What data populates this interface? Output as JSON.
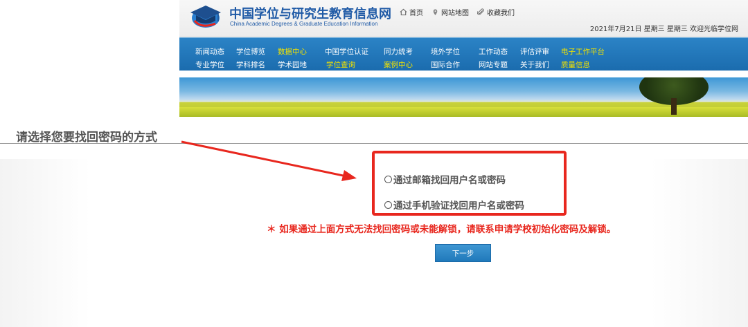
{
  "header": {
    "site_title": "中国学位与研究生教育信息网",
    "site_subtitle": "China Academic Degrees & Graduate Education Information",
    "top_links": [
      {
        "label": "首页",
        "icon": "home-icon"
      },
      {
        "label": "网站地图",
        "icon": "location-pin-icon"
      },
      {
        "label": "收藏我们",
        "icon": "paperclip-icon"
      }
    ],
    "dateline": "2021年7月21日  星期三  星期三  欢迎光临学位网"
  },
  "nav": {
    "row1": [
      {
        "label": "新闻动态",
        "highlight": false
      },
      {
        "label": "学位博览",
        "highlight": false
      },
      {
        "label": "数据中心",
        "highlight": true
      },
      {
        "label": "中国学位认证",
        "highlight": false
      },
      {
        "label": "同力统考",
        "highlight": false
      },
      {
        "label": "境外学位",
        "highlight": false
      },
      {
        "label": "工作动态",
        "highlight": false
      },
      {
        "label": "评估评审",
        "highlight": false
      },
      {
        "label": "电子工作平台",
        "highlight": true
      }
    ],
    "row2": [
      {
        "label": "专业学位",
        "highlight": false
      },
      {
        "label": "学科排名",
        "highlight": false
      },
      {
        "label": "学术园地",
        "highlight": false
      },
      {
        "label": "学位查询",
        "highlight": true
      },
      {
        "label": "案例中心",
        "highlight": true
      },
      {
        "label": "国际合作",
        "highlight": false
      },
      {
        "label": "网站专题",
        "highlight": false
      },
      {
        "label": "关于我们",
        "highlight": false
      },
      {
        "label": "质量信息",
        "highlight": true
      }
    ],
    "highlight_color": "#f2e200"
  },
  "main": {
    "heading": "请选择您要找回密码的方式",
    "options": [
      {
        "label": "通过邮箱找回用户名或密码",
        "selected": false
      },
      {
        "label": "通过手机验证找回用户名或密码",
        "selected": false
      }
    ],
    "notice": "＊ 如果通过上面方式无法找回密码或未能解锁，请联系申请学校初始化密码及解锁。",
    "next_button": "下一步"
  },
  "colors": {
    "brand_blue": "#1f5aa6",
    "nav_blue": "#1b6cae",
    "annotation_red": "#e8271e"
  }
}
